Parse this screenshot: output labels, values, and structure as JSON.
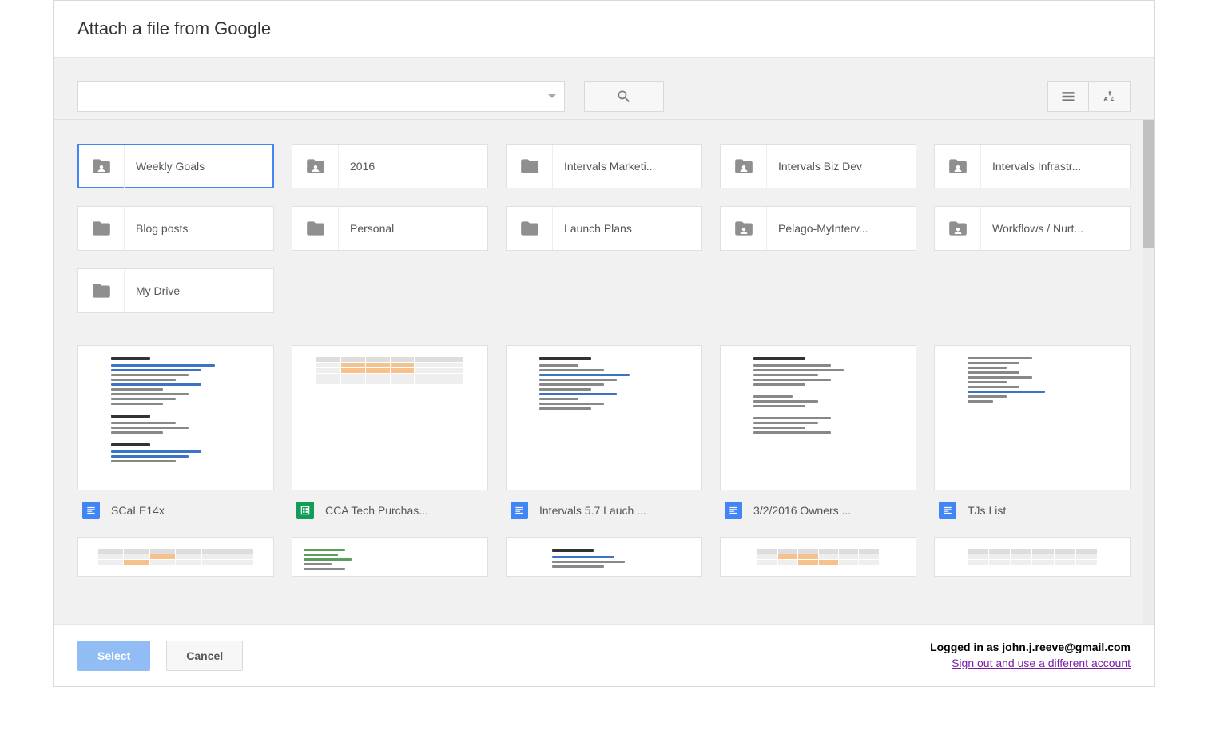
{
  "header": {
    "title": "Attach a file from Google"
  },
  "toolbar": {
    "search_placeholder": ""
  },
  "folders": [
    {
      "label": "Weekly Goals",
      "shared": true,
      "selected": true
    },
    {
      "label": "2016",
      "shared": true,
      "selected": false
    },
    {
      "label": "Intervals Marketi...",
      "shared": false,
      "selected": false
    },
    {
      "label": "Intervals Biz Dev",
      "shared": true,
      "selected": false
    },
    {
      "label": "Intervals Infrastr...",
      "shared": true,
      "selected": false
    },
    {
      "label": "Blog posts",
      "shared": false,
      "selected": false
    },
    {
      "label": "Personal",
      "shared": false,
      "selected": false
    },
    {
      "label": "Launch Plans",
      "shared": false,
      "selected": false
    },
    {
      "label": "Pelago-MyInterv...",
      "shared": true,
      "selected": false
    },
    {
      "label": "Workflows / Nurt...",
      "shared": true,
      "selected": false
    },
    {
      "label": "My Drive",
      "shared": false,
      "selected": false
    }
  ],
  "files": [
    {
      "label": "SCaLE14x",
      "type": "doc"
    },
    {
      "label": "CCA Tech Purchas...",
      "type": "sheet"
    },
    {
      "label": "Intervals 5.7 Lauch ...",
      "type": "doc"
    },
    {
      "label": "3/2/2016 Owners ...",
      "type": "doc"
    },
    {
      "label": "TJs List",
      "type": "doc"
    }
  ],
  "footer": {
    "select_label": "Select",
    "cancel_label": "Cancel",
    "logged_in_prefix": "Logged in as ",
    "email": "john.j.reeve@gmail.com",
    "signout_label": "Sign out and use a different account"
  }
}
